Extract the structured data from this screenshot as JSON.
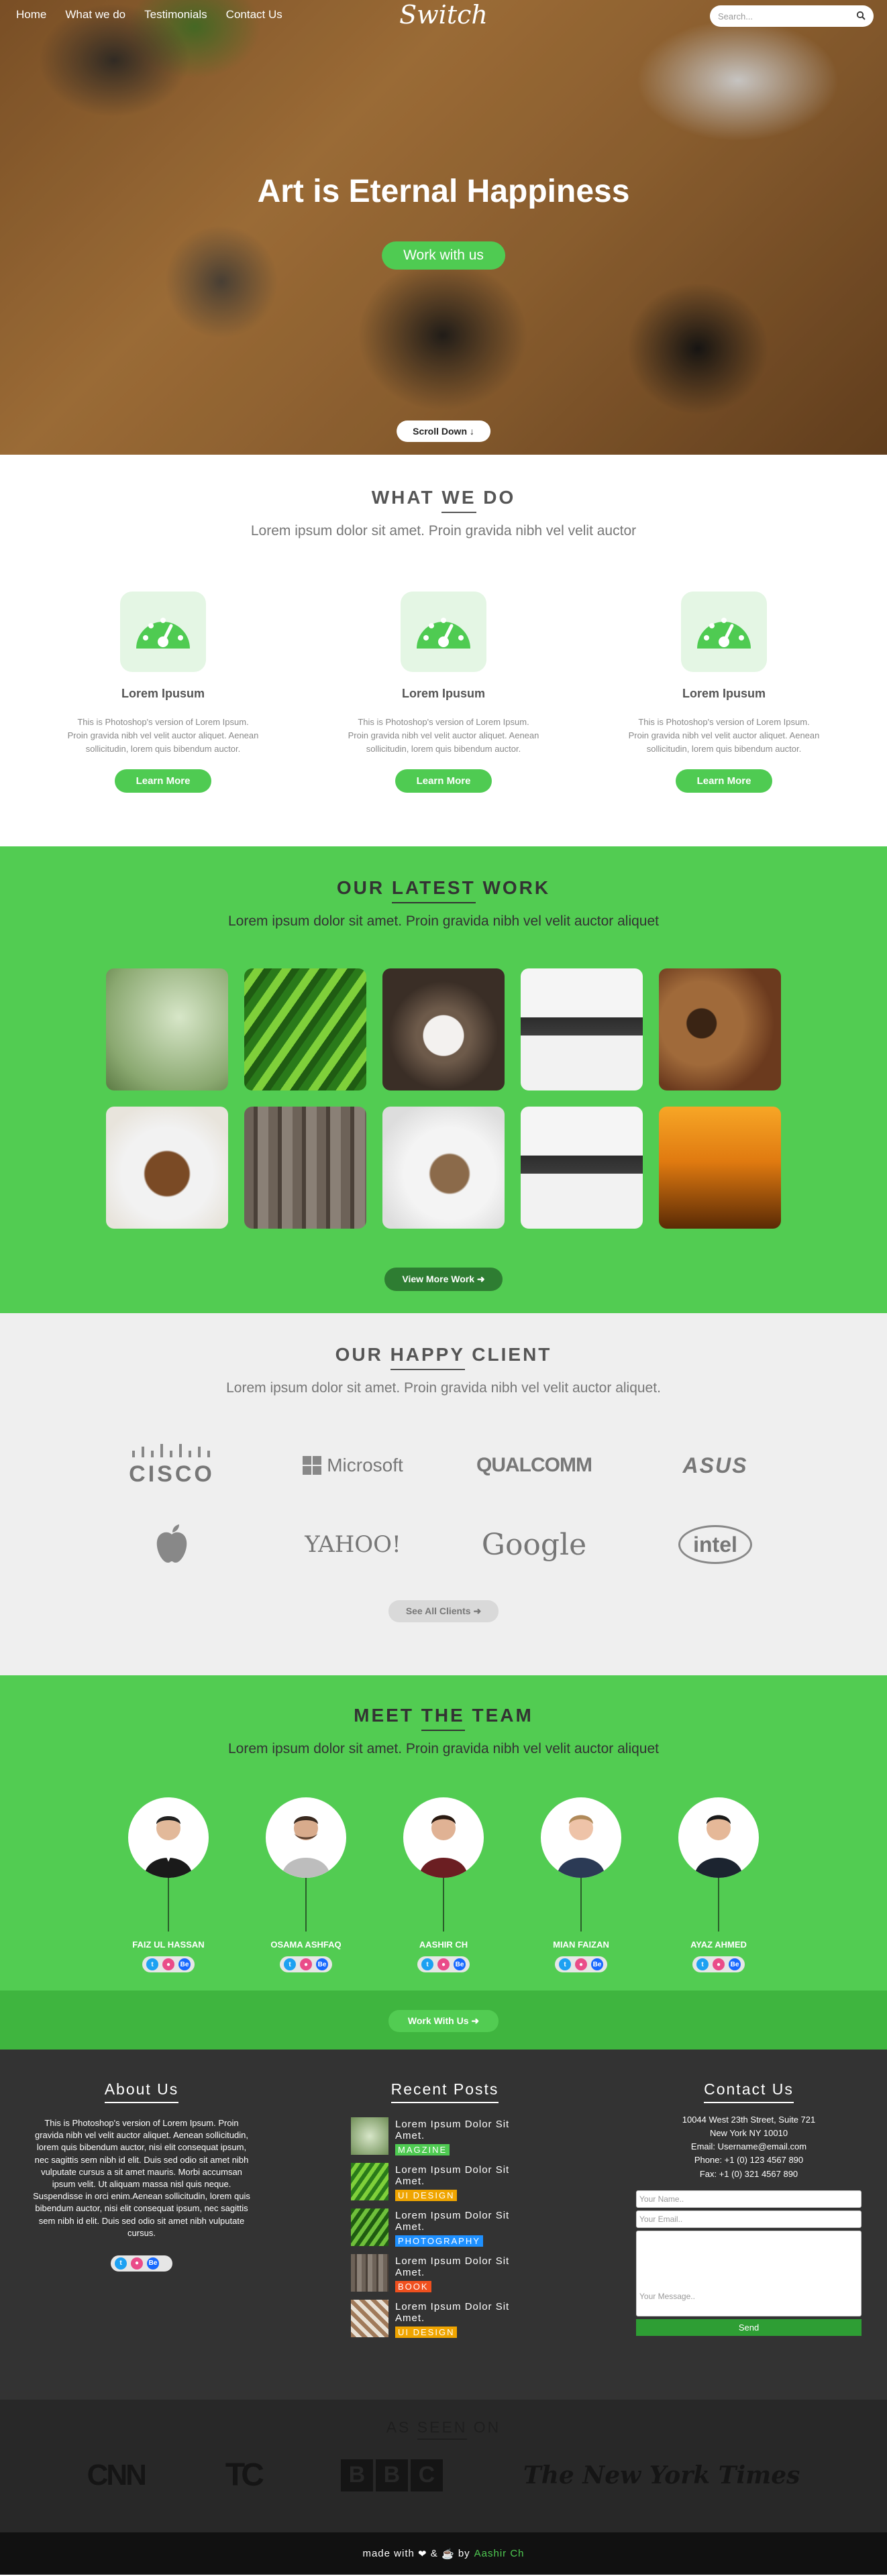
{
  "nav": {
    "items": [
      "Home",
      "What we do",
      "Testimonials",
      "Contact Us"
    ],
    "logo": "Switch",
    "search_placeholder": "Search..."
  },
  "hero": {
    "title": "Art is Eternal Happiness",
    "button": "Work with us",
    "scroll": "Scroll Down"
  },
  "what": {
    "title_pre": "WHAT ",
    "title_u": "WE",
    "title_post": " DO",
    "subtitle": "Lorem ipsum dolor sit amet. Proin gravida nibh vel velit auctor",
    "cards": [
      {
        "title": "Lorem Ipusum",
        "text": "This is Photoshop's version of Lorem Ipsum. Proin gravida nibh vel velit auctor aliquet. Aenean sollicitudin, lorem quis bibendum auctor.",
        "button": "Learn More"
      },
      {
        "title": "Lorem Ipusum",
        "text": "This is Photoshop's version of Lorem Ipsum. Proin gravida nibh vel velit auctor aliquet. Aenean sollicitudin, lorem quis bibendum auctor.",
        "button": "Learn More"
      },
      {
        "title": "Lorem Ipusum",
        "text": "This is Photoshop's version of Lorem Ipsum. Proin gravida nibh vel velit auctor aliquet. Aenean sollicitudin, lorem quis bibendum auctor.",
        "button": "Learn More"
      }
    ]
  },
  "work": {
    "title_pre": "OUR ",
    "title_u": "LATEST",
    "title_post": " WORK",
    "subtitle": "Lorem ipsum dolor sit amet. Proin gravida nibh vel velit auctor aliquet",
    "button": "View More Work"
  },
  "clients": {
    "title_pre": "OUR ",
    "title_u": "HAPPY",
    "title_post": " CLIENT",
    "subtitle": "Lorem ipsum dolor sit amet. Proin gravida nibh vel velit auctor aliquet.",
    "logos": [
      "CISCO",
      "Microsoft",
      "QUALCOMM",
      "ASUS",
      "Apple",
      "YAHOO!",
      "Google",
      "intel"
    ],
    "button": "See All Clients"
  },
  "team": {
    "title_pre": "MEET ",
    "title_u": "THE",
    "title_post": " TEAM",
    "subtitle": "Lorem ipsum dolor sit amet. Proin gravida nibh vel velit auctor aliquet",
    "members": [
      "FAIZ UL HASSAN",
      "OSAMA ASHFAQ",
      "AASHIR CH",
      "MIAN FAIZAN",
      "AYAZ AHMED"
    ],
    "button": "Work With Us"
  },
  "footer": {
    "about_title": "About Us",
    "about_text": "This is Photoshop's version of Lorem Ipsum. Proin gravida nibh vel velit auctor aliquet. Aenean sollicitudin, lorem quis bibendum auctor, nisi elit consequat ipsum, nec sagittis sem nibh id elit. Duis sed odio sit amet nibh vulputate cursus a sit amet mauris. Morbi accumsan ipsum velit. Ut aliquam massa nisl quis neque. Suspendisse in orci enim.Aenean sollicitudin, lorem quis bibendum auctor, nisi elit consequat ipsum, nec sagittis sem nibh id elit. Duis sed odio sit amet nibh vulputate cursus.",
    "posts_title": "Recent Posts",
    "posts": [
      {
        "title": "Lorem Ipsum Dolor Sit Amet.",
        "tag": "MAGZINE",
        "color": "#4fcb52"
      },
      {
        "title": "Lorem Ipsum Dolor Sit Amet.",
        "tag": "UI DESIGN",
        "color": "#f0a500"
      },
      {
        "title": "Lorem Ipsum Dolor Sit Amet.",
        "tag": "PHOTOGRAPHY",
        "color": "#1e90ff"
      },
      {
        "title": "Lorem Ipsum Dolor Sit Amet.",
        "tag": "BOOK",
        "color": "#f0501e"
      },
      {
        "title": "Lorem Ipsum Dolor Sit Amet.",
        "tag": "UI DESIGN",
        "color": "#f0a500"
      }
    ],
    "contact_title": "Contact Us",
    "address": [
      "10044 West 23th Street, Suite 721",
      "New York NY 10010",
      "Email: Username@email.com",
      "Phone: +1 (0) 123 4567 890",
      "Fax: +1 (0) 321 4567 890"
    ],
    "name_ph": "Your Name..",
    "email_ph": "Your Email..",
    "message_ph": "Your Message..",
    "send": "Send"
  },
  "seen": {
    "title_pre": "AS ",
    "title_u": "SEEN",
    "title_post": " ON",
    "brands": [
      "CNN",
      "TC",
      "BBC",
      "The New York Times"
    ]
  },
  "bottom": {
    "made": "made with",
    "amp": "&",
    "by": "by",
    "credit": "Aashir Ch"
  },
  "colors": {
    "accent": "#4fcb52",
    "dark_green": "#2e7d32",
    "footer_bg": "#333333"
  }
}
